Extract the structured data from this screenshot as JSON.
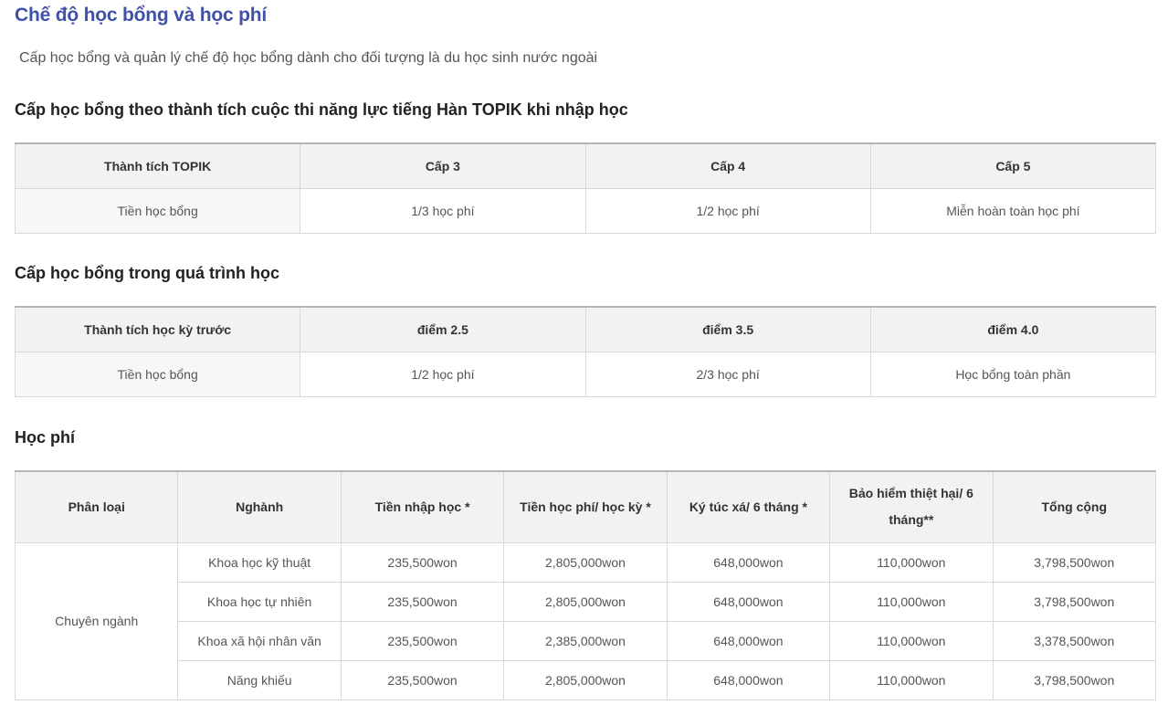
{
  "page": {
    "title": "Chế độ học bổng và học phí",
    "intro": "Cấp học bổng và quản lý chế độ học bổng dành cho đối tượng là du học sinh nước ngoài"
  },
  "topik": {
    "heading": "Cấp học bổng theo thành tích cuộc thi năng lực tiếng Hàn TOPIK khi nhập học",
    "headers": [
      "Thành tích TOPIK",
      "Cấp 3",
      "Cấp 4",
      "Cấp 5"
    ],
    "row": [
      "Tiền học bổng",
      "1/3 học phí",
      "1/2 học phí",
      "Miễn hoàn toàn học phí"
    ]
  },
  "semester": {
    "heading": "Cấp học bổng trong quá trình học",
    "headers": [
      "Thành tích học kỳ trước",
      "điểm 2.5",
      "điểm 3.5",
      "điểm 4.0"
    ],
    "row": [
      "Tiền học bổng",
      "1/2 học phí",
      "2/3 học phí",
      "Học bổng toàn phần"
    ]
  },
  "fees": {
    "heading": "Học phí",
    "headers": [
      "Phân loại",
      "Nghành",
      "Tiền nhập học *",
      "Tiền học phí/ học kỳ *",
      "Ký túc xá/ 6 tháng *",
      "Bảo hiểm thiệt hại/ 6 tháng**",
      "Tổng cộng"
    ],
    "category": "Chuyên ngành",
    "rows": [
      [
        "Khoa học kỹ thuật",
        "235,500won",
        "2,805,000won",
        "648,000won",
        "110,000won",
        "3,798,500won"
      ],
      [
        "Khoa học tự nhiên",
        "235,500won",
        "2,805,000won",
        "648,000won",
        "110,000won",
        "3,798,500won"
      ],
      [
        "Khoa xã hội nhân văn",
        "235,500won",
        "2,385,000won",
        "648,000won",
        "110,000won",
        "3,378,500won"
      ],
      [
        "Năng khiếu",
        "235,500won",
        "2,805,000won",
        "648,000won",
        "110,000won",
        "3,798,500won"
      ]
    ]
  }
}
